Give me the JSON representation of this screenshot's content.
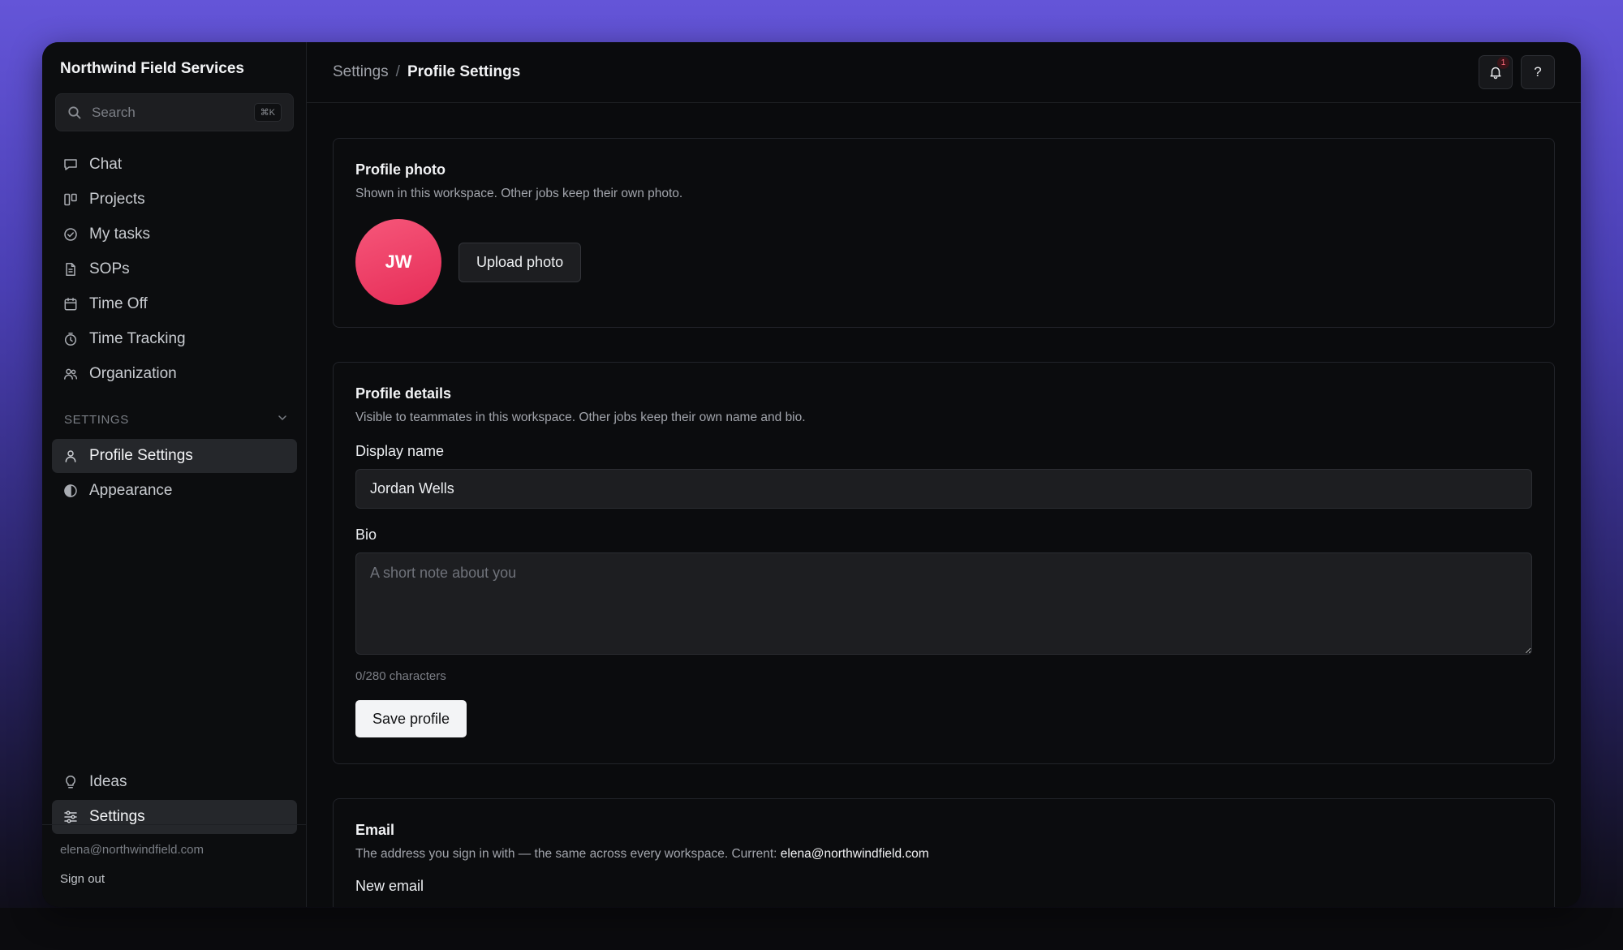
{
  "workspace": {
    "name": "Northwind Field Services"
  },
  "search": {
    "placeholder": "Search",
    "shortcut": "⌘K"
  },
  "nav": {
    "items": [
      {
        "label": "Chat",
        "icon": "chat-icon"
      },
      {
        "label": "Projects",
        "icon": "projects-icon"
      },
      {
        "label": "My tasks",
        "icon": "check-circle-icon"
      },
      {
        "label": "SOPs",
        "icon": "document-icon"
      },
      {
        "label": "Time Off",
        "icon": "calendar-icon"
      },
      {
        "label": "Time Tracking",
        "icon": "stopwatch-icon"
      },
      {
        "label": "Organization",
        "icon": "users-icon"
      }
    ],
    "settings_section": "SETTINGS",
    "settings_items": [
      {
        "label": "Profile Settings",
        "icon": "user-icon",
        "active": true
      },
      {
        "label": "Appearance",
        "icon": "contrast-icon"
      }
    ],
    "bottom_items": [
      {
        "label": "Ideas",
        "icon": "lightbulb-icon"
      },
      {
        "label": "Settings",
        "icon": "sliders-icon",
        "active": true
      }
    ]
  },
  "footer": {
    "email": "elena@northwindfield.com",
    "signout": "Sign out"
  },
  "breadcrumb": {
    "parent": "Settings",
    "separator": "/",
    "current": "Profile Settings"
  },
  "topbar": {
    "notifications_count": "1",
    "help_label": "?"
  },
  "profile_photo": {
    "title": "Profile photo",
    "description": "Shown in this workspace. Other jobs keep their own photo.",
    "initials": "JW",
    "upload_label": "Upload photo"
  },
  "profile_details": {
    "title": "Profile details",
    "description": "Visible to teammates in this workspace. Other jobs keep their own name and bio.",
    "display_name_label": "Display name",
    "display_name_value": "Jordan Wells",
    "bio_label": "Bio",
    "bio_placeholder": "A short note about you",
    "char_count": "0/280 characters",
    "save_label": "Save profile"
  },
  "email_section": {
    "title": "Email",
    "description": "The address you sign in with — the same across every workspace. Current:",
    "current_email": "elena@northwindfield.com",
    "new_email_label": "New email"
  },
  "colors": {
    "background_top": "#6455d8",
    "window_bg": "#0a0b0d",
    "avatar": "#ef3f66",
    "primary_button": "#f3f4f6"
  }
}
